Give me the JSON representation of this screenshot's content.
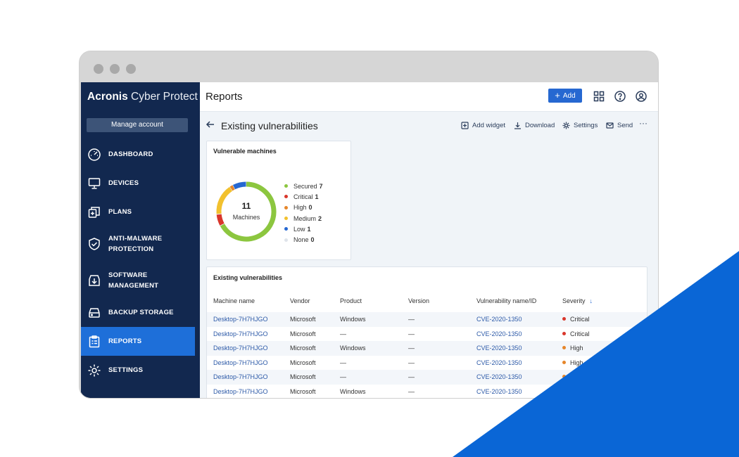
{
  "colors": {
    "sidebar_bg": "#12284f",
    "accent": "#1e6fd9",
    "secured": "#8cc63f",
    "critical": "#d9362b",
    "high": "#e6862a",
    "medium": "#f2c12e",
    "low": "#2668d1",
    "none": "#dfe4ea"
  },
  "sidebar": {
    "brand_bold": "Acronis",
    "brand_light": " Cyber Protect",
    "manage_account": "Manage account",
    "items": [
      {
        "label": "DASHBOARD",
        "icon": "gauge-icon"
      },
      {
        "label": "DEVICES",
        "icon": "monitor-icon"
      },
      {
        "label": "PLANS",
        "icon": "plans-icon"
      },
      {
        "label": "ANTI-MALWARE\nPROTECTION",
        "icon": "shield-icon"
      },
      {
        "label": "SOFTWARE\nMANAGEMENT",
        "icon": "download-box-icon"
      },
      {
        "label": "BACKUP STORAGE",
        "icon": "storage-icon"
      },
      {
        "label": "REPORTS",
        "icon": "clipboard-icon",
        "active": true
      },
      {
        "label": "SETTINGS",
        "icon": "gear-icon"
      }
    ]
  },
  "header": {
    "title": "Reports",
    "add_label": "Add"
  },
  "subheader": {
    "title": "Existing vulnerabilities",
    "actions": {
      "add_widget": "Add widget",
      "download": "Download",
      "settings": "Settings",
      "send": "Send"
    }
  },
  "widget": {
    "title": "Vulnerable machines",
    "total": "11",
    "total_label": "Machines",
    "legend": [
      {
        "label": "Secured",
        "value": "7"
      },
      {
        "label": "Critical",
        "value": "1"
      },
      {
        "label": "High",
        "value": "0"
      },
      {
        "label": "Medium",
        "value": "2"
      },
      {
        "label": "Low",
        "value": "1"
      },
      {
        "label": "None",
        "value": "0"
      }
    ]
  },
  "table": {
    "title": "Existing vulnerabilities",
    "columns": {
      "machine": "Machine name",
      "vendor": "Vendor",
      "product": "Product",
      "version": "Version",
      "vuln": "Vulnerability name/ID",
      "severity": "Severity"
    },
    "rows": [
      {
        "machine": "Desktop-7H7HJGO",
        "vendor": "Microsoft",
        "product": "Windows",
        "version": "—",
        "vuln": "CVE-2020-1350",
        "severity": "Critical"
      },
      {
        "machine": "Desktop-7H7HJGO",
        "vendor": "Microsoft",
        "product": "—",
        "version": "—",
        "vuln": "CVE-2020-1350",
        "severity": "Critical"
      },
      {
        "machine": "Desktop-7H7HJGO",
        "vendor": "Microsoft",
        "product": "Windows",
        "version": "—",
        "vuln": "CVE-2020-1350",
        "severity": "High"
      },
      {
        "machine": "Desktop-7H7HJGO",
        "vendor": "Microsoft",
        "product": "—",
        "version": "—",
        "vuln": "CVE-2020-1350",
        "severity": "High"
      },
      {
        "machine": "Desktop-7H7HJGO",
        "vendor": "Microsoft",
        "product": "—",
        "version": "—",
        "vuln": "CVE-2020-1350",
        "severity": ""
      },
      {
        "machine": "Desktop-7H7HJGO",
        "vendor": "Microsoft",
        "product": "Windows",
        "version": "—",
        "vuln": "CVE-2020-1350",
        "severity": ""
      }
    ]
  }
}
